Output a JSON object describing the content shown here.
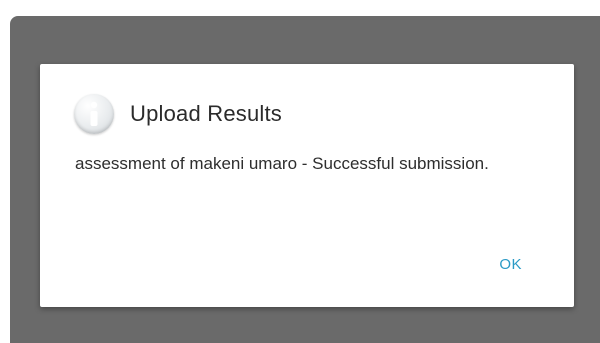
{
  "dialog": {
    "icon": "info-icon",
    "title": "Upload Results",
    "message": "assessment of makeni umaro - Successful submission.",
    "ok_label": "OK"
  },
  "colors": {
    "overlay": "#6a6a6a",
    "dialog_background": "#ffffff",
    "accent": "#2a9ac6"
  }
}
